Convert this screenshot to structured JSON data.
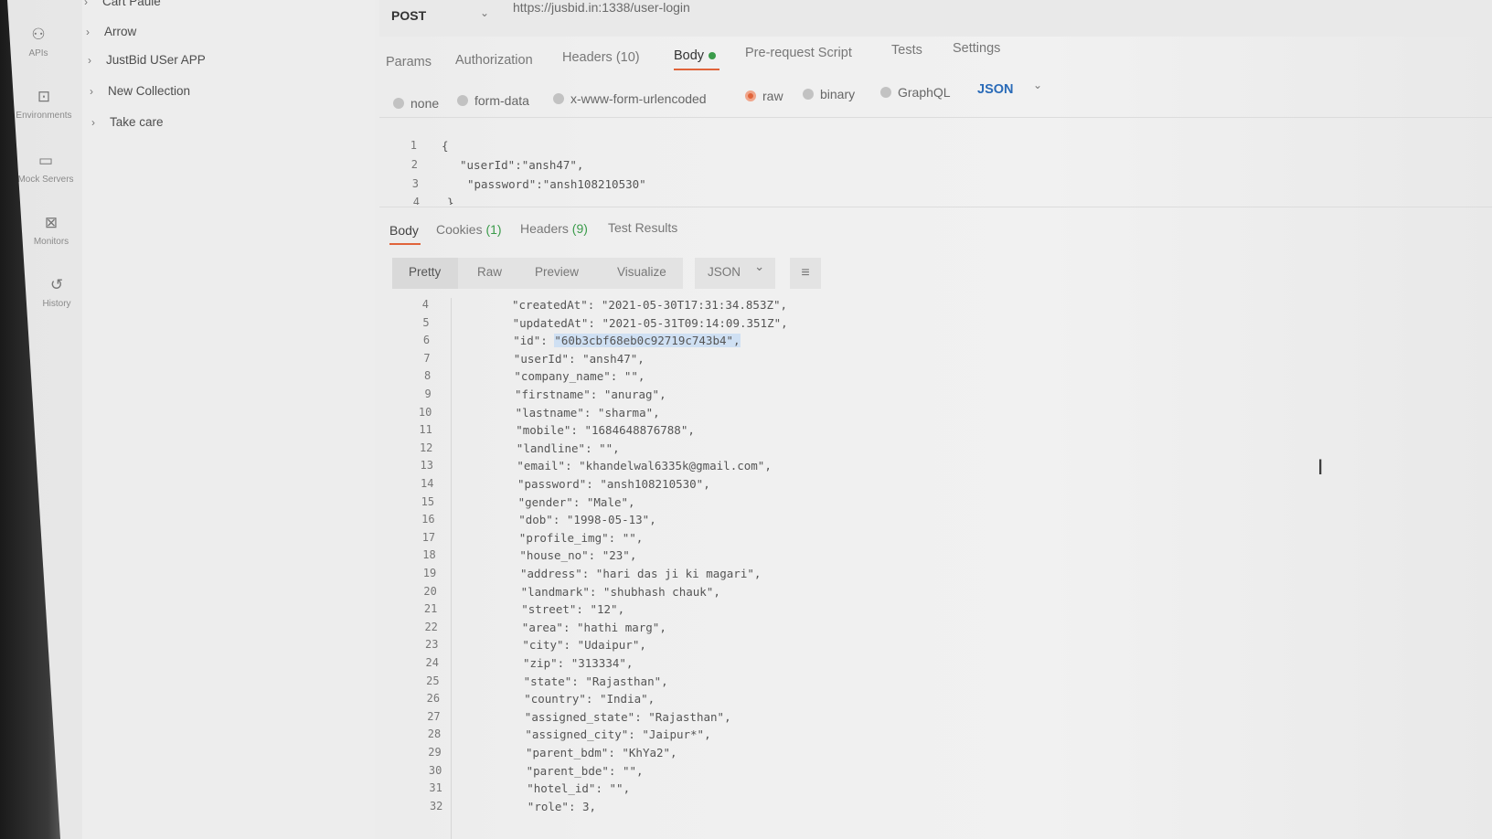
{
  "sidebar": {
    "items": [
      {
        "label": "APIs",
        "icon": "apis-icon",
        "glyph": "⚇"
      },
      {
        "label": "Environments",
        "icon": "environments-icon",
        "glyph": "⊡"
      },
      {
        "label": "Mock Servers",
        "icon": "mock-servers-icon",
        "glyph": "▭"
      },
      {
        "label": "Monitors",
        "icon": "monitors-icon",
        "glyph": "⊠"
      },
      {
        "label": "History",
        "icon": "history-icon",
        "glyph": "↺"
      }
    ]
  },
  "collections": {
    "items": [
      "Cart Paule",
      "Arrow",
      "JustBid USer APP",
      "New Collection",
      "Take care"
    ]
  },
  "request": {
    "method": "POST",
    "url": "https://jusbid.in:1338/user-login",
    "tabs": [
      "Params",
      "Authorization",
      "Headers (10)",
      "Body",
      "Pre-request Script",
      "Tests",
      "Settings"
    ],
    "active_tab": "Body",
    "body_types": [
      "none",
      "form-data",
      "x-www-form-urlencoded",
      "raw",
      "binary",
      "GraphQL"
    ],
    "selected_body_type": "raw",
    "raw_format": "JSON",
    "editor": {
      "line_numbers": [
        "1",
        "2",
        "3",
        "4"
      ],
      "lines": [
        "{",
        "\"userId\":\"ansh47\",",
        "\"password\":\"ansh108210530\"",
        "}"
      ]
    }
  },
  "response": {
    "tabs": [
      {
        "label": "Body",
        "count": ""
      },
      {
        "label": "Cookies",
        "count": "(1)"
      },
      {
        "label": "Headers",
        "count": "(9)"
      },
      {
        "label": "Test Results",
        "count": ""
      }
    ],
    "view_modes": [
      "Pretty",
      "Raw",
      "Preview",
      "Visualize"
    ],
    "active_view": "Pretty",
    "format": "JSON",
    "lines": [
      {
        "n": "4",
        "key": "\"createdAt\"",
        "val": "\"2021-05-30T17:31:34.853Z\","
      },
      {
        "n": "5",
        "key": "\"updatedAt\"",
        "val": "\"2021-05-31T09:14:09.351Z\","
      },
      {
        "n": "6",
        "key": "\"id\"",
        "val": "\"60b3cbf68eb0c92719c743b4\","
      },
      {
        "n": "7",
        "key": "\"userId\"",
        "val": "\"ansh47\","
      },
      {
        "n": "8",
        "key": "\"company_name\"",
        "val": "\"\","
      },
      {
        "n": "9",
        "key": "\"firstname\"",
        "val": "\"anurag\","
      },
      {
        "n": "10",
        "key": "\"lastname\"",
        "val": "\"sharma\","
      },
      {
        "n": "11",
        "key": "\"mobile\"",
        "val": "\"1684648876788\","
      },
      {
        "n": "12",
        "key": "\"landline\"",
        "val": "\"\","
      },
      {
        "n": "13",
        "key": "\"email\"",
        "val": "\"khandelwal6335k@gmail.com\","
      },
      {
        "n": "14",
        "key": "\"password\"",
        "val": "\"ansh108210530\","
      },
      {
        "n": "15",
        "key": "\"gender\"",
        "val": "\"Male\","
      },
      {
        "n": "16",
        "key": "\"dob\"",
        "val": "\"1998-05-13\","
      },
      {
        "n": "17",
        "key": "\"profile_img\"",
        "val": "\"\","
      },
      {
        "n": "18",
        "key": "\"house_no\"",
        "val": "\"23\","
      },
      {
        "n": "19",
        "key": "\"address\"",
        "val": "\"hari das ji ki magari\","
      },
      {
        "n": "20",
        "key": "\"landmark\"",
        "val": "\"shubhash chauk\","
      },
      {
        "n": "21",
        "key": "\"street\"",
        "val": "\"12\","
      },
      {
        "n": "22",
        "key": "\"area\"",
        "val": "\"hathi marg\","
      },
      {
        "n": "23",
        "key": "\"city\"",
        "val": "\"Udaipur\","
      },
      {
        "n": "24",
        "key": "\"zip\"",
        "val": "\"313334\","
      },
      {
        "n": "25",
        "key": "\"state\"",
        "val": "\"Rajasthan\","
      },
      {
        "n": "26",
        "key": "\"country\"",
        "val": "\"India\","
      },
      {
        "n": "27",
        "key": "\"assigned_state\"",
        "val": "\"Rajasthan\","
      },
      {
        "n": "28",
        "key": "\"assigned_city\"",
        "val": "\"Jaipur*\","
      },
      {
        "n": "29",
        "key": "\"parent_bdm\"",
        "val": "\"KhYa2\","
      },
      {
        "n": "30",
        "key": "\"parent_bde\"",
        "val": "\"\","
      },
      {
        "n": "31",
        "key": "\"hotel_id\"",
        "val": "\"\","
      },
      {
        "n": "32",
        "key": "\"role\"",
        "val": "3,"
      }
    ]
  },
  "colors": {
    "accent": "#e0643a",
    "json_blue": "#2a6bb8",
    "status_green": "#3a9b4a"
  }
}
